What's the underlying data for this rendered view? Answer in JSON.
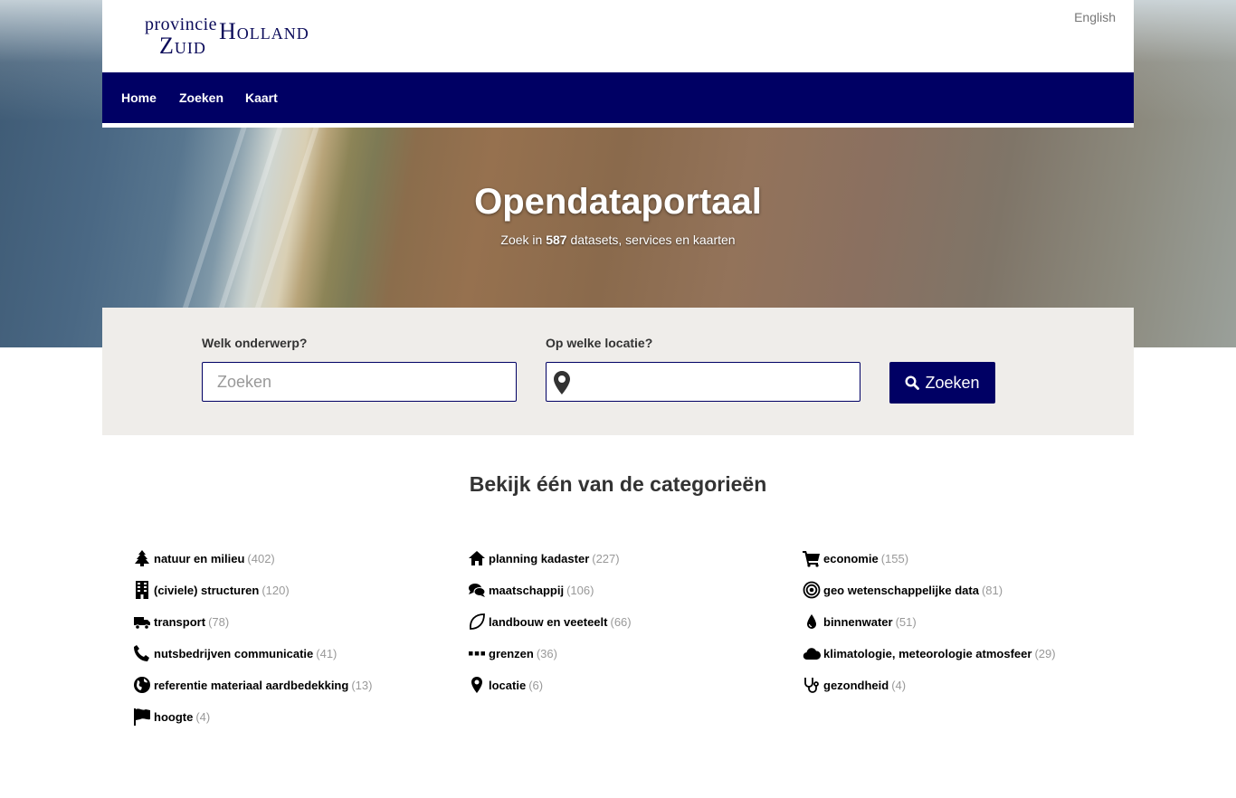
{
  "header": {
    "logo_line1": "provincie",
    "logo_line2": "Zuid",
    "logo_line3": "Holland",
    "language_link": "English"
  },
  "nav": {
    "items": [
      "Home",
      "Zoeken",
      "Kaart"
    ]
  },
  "hero": {
    "title": "Opendataportaal",
    "sub_prefix": "Zoek in",
    "sub_count": "587",
    "sub_suffix": "datasets, services en kaarten"
  },
  "search": {
    "subject_label": "Welk onderwerp?",
    "subject_placeholder": "Zoeken",
    "location_label": "Op welke locatie?",
    "location_value": "",
    "button_label": "Zoeken"
  },
  "categories": {
    "title": "Bekijk één van de categorieën",
    "items": [
      {
        "label": "natuur en milieu",
        "count": "(402)",
        "icon": "tree-icon"
      },
      {
        "label": "planning kadaster",
        "count": "(227)",
        "icon": "home-icon"
      },
      {
        "label": "economie",
        "count": "(155)",
        "icon": "cart-icon"
      },
      {
        "label": "(civiele) structuren",
        "count": "(120)",
        "icon": "building-icon"
      },
      {
        "label": "maatschappij",
        "count": "(106)",
        "icon": "comments-icon"
      },
      {
        "label": "geo wetenschappelijke data",
        "count": "(81)",
        "icon": "target-icon"
      },
      {
        "label": "transport",
        "count": "(78)",
        "icon": "truck-icon"
      },
      {
        "label": "landbouw en veeteelt",
        "count": "(66)",
        "icon": "leaf-icon"
      },
      {
        "label": "binnenwater",
        "count": "(51)",
        "icon": "drop-icon"
      },
      {
        "label": "nutsbedrijven communicatie",
        "count": "(41)",
        "icon": "phone-icon"
      },
      {
        "label": "grenzen",
        "count": "(36)",
        "icon": "dots-icon"
      },
      {
        "label": "klimatologie, meteorologie atmosfeer",
        "count": "(29)",
        "icon": "cloud-icon"
      },
      {
        "label": "referentie materiaal aardbedekking",
        "count": "(13)",
        "icon": "globe-icon"
      },
      {
        "label": "locatie",
        "count": "(6)",
        "icon": "map-marker-icon"
      },
      {
        "label": "gezondheid",
        "count": "(4)",
        "icon": "stethoscope-icon"
      },
      {
        "label": "hoogte",
        "count": "(4)",
        "icon": "flag-icon"
      }
    ]
  },
  "colors": {
    "brand_navy": "#000064",
    "panel_bg": "#efedea",
    "count_grey": "#999999"
  }
}
